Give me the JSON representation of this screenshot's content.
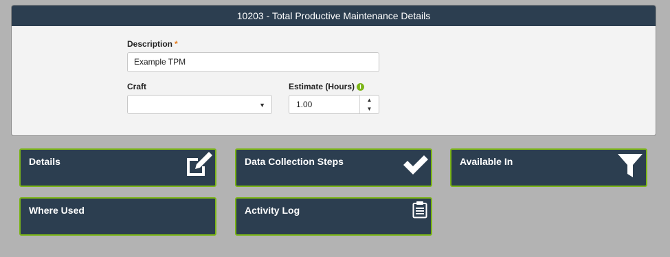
{
  "panel": {
    "title": "10203 - Total Productive Maintenance Details"
  },
  "form": {
    "description": {
      "label": "Description",
      "required_marker": "*",
      "value": "Example TPM"
    },
    "craft": {
      "label": "Craft",
      "value": ""
    },
    "estimate": {
      "label": "Estimate (Hours)",
      "value": "1.00",
      "info_icon": "info-icon"
    }
  },
  "tiles": [
    {
      "label": "Details",
      "icon": "edit-icon"
    },
    {
      "label": "Data Collection Steps",
      "icon": "checkmark-icon"
    },
    {
      "label": "Available In",
      "icon": "filter-icon"
    },
    {
      "label": "Where Used",
      "icon": ""
    },
    {
      "label": "Activity Log",
      "icon": "clipboard-icon"
    }
  ],
  "colors": {
    "header_bg": "#2c3e50",
    "tile_border": "#7cb518",
    "required": "#e67e22",
    "page_bg": "#b3b3b3"
  }
}
